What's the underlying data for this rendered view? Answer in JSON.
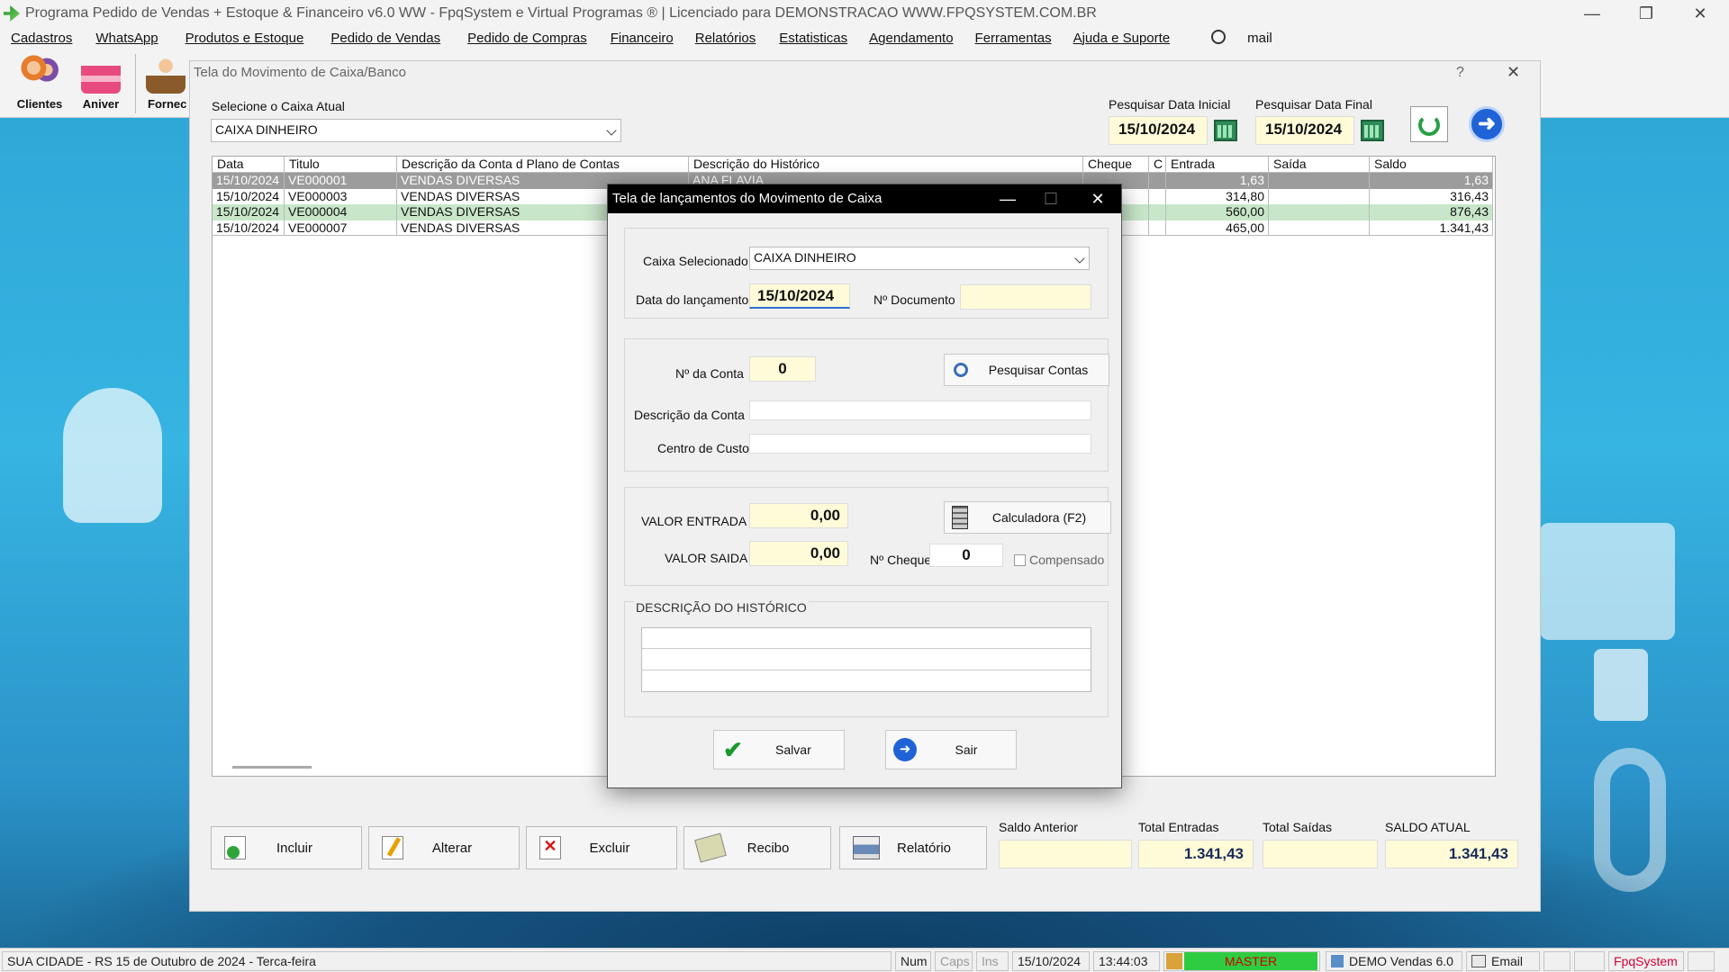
{
  "app": {
    "title": "Programa Pedido de Vendas + Estoque & Financeiro v6.0 WW - FpqSystem e Virtual Programas ® | Licenciado para  DEMONSTRACAO WWW.FPQSYSTEM.COM.BR"
  },
  "menu": [
    "Cadastros",
    "WhatsApp",
    "Produtos e Estoque",
    "Pedido de Vendas",
    "Pedido de Compras",
    "Financeiro",
    "Relatórios",
    "Estatisticas",
    "Agendamento",
    "Ferramentas",
    "Ajuda e Suporte",
    "mail"
  ],
  "toolbar": {
    "clientes": "Clientes",
    "aniver": "Aniver",
    "fornec": "Fornec"
  },
  "mainwin": {
    "title": "Tela do Movimento de Caixa/Banco",
    "help": "?",
    "close": "✕",
    "caixa_label": "Selecione o Caixa Atual",
    "caixa_value": "CAIXA DINHEIRO",
    "data_ini_label": "Pesquisar Data Inicial",
    "data_ini": "15/10/2024",
    "data_fim_label": "Pesquisar Data Final",
    "data_fim": "15/10/2024"
  },
  "table": {
    "headers": [
      "Data",
      "Titulo",
      "Descrição da Conta d Plano de Contas",
      "Descrição do Histórico",
      "Cheque",
      "C",
      "Entrada",
      "Saída",
      "Saldo"
    ],
    "rows": [
      {
        "data": "15/10/2024",
        "titulo": "VE000001",
        "conta": "VENDAS DIVERSAS",
        "hist": "ANA FLAVIA",
        "entrada": "1,63",
        "saida": "",
        "saldo": "1,63"
      },
      {
        "data": "15/10/2024",
        "titulo": "VE000003",
        "conta": "VENDAS DIVERSAS",
        "hist": "",
        "entrada": "314,80",
        "saida": "",
        "saldo": "316,43"
      },
      {
        "data": "15/10/2024",
        "titulo": "VE000004",
        "conta": "VENDAS DIVERSAS",
        "hist": "",
        "entrada": "560,00",
        "saida": "",
        "saldo": "876,43"
      },
      {
        "data": "15/10/2024",
        "titulo": "VE000007",
        "conta": "VENDAS DIVERSAS",
        "hist": "",
        "entrada": "465,00",
        "saida": "",
        "saldo": "1.341,43"
      }
    ]
  },
  "buttons": {
    "incluir": "Incluir",
    "alterar": "Alterar",
    "excluir": "Excluir",
    "recibo": "Recibo",
    "relatorio": "Relatório"
  },
  "totals": {
    "saldo_anterior_label": "Saldo Anterior",
    "saldo_anterior": "",
    "total_entradas_label": "Total Entradas",
    "total_entradas": "1.341,43",
    "total_saidas_label": "Total Saídas",
    "total_saidas": "",
    "saldo_atual_label": "SALDO ATUAL",
    "saldo_atual": "1.341,43"
  },
  "dialog": {
    "title": "Tela de lançamentos do Movimento de Caixa",
    "caixa_label": "Caixa Selecionado",
    "caixa_value": "CAIXA DINHEIRO",
    "data_label": "Data do lançamento",
    "data_value": "15/10/2024",
    "doc_label": "Nº Documento",
    "doc_value": "",
    "conta_label": "Nº da Conta",
    "conta_value": "0",
    "pesquisar_label": "Pesquisar Contas",
    "desc_conta_label": "Descrição da Conta",
    "desc_conta_value": "",
    "centro_label": "Centro de Custo",
    "centro_value": "",
    "entrada_label": "VALOR ENTRADA",
    "entrada_value": "0,00",
    "calc_label": "Calculadora  (F2)",
    "saida_label": "VALOR SAIDA",
    "saida_value": "0,00",
    "cheque_label": "Nº Cheque",
    "cheque_value": "0",
    "compensado_label": "Compensado",
    "hist_label": "DESCRIÇÃO DO HISTÓRICO",
    "salvar_label": "Salvar",
    "sair_label": "Sair"
  },
  "status": {
    "cidade": "SUA CIDADE - RS 15 de Outubro de 2024 - Terca-feira",
    "num": "Num",
    "caps": "Caps",
    "ins": "Ins",
    "date": "15/10/2024",
    "time": "13:44:03",
    "master": "MASTER",
    "demo": "DEMO Vendas 6.0",
    "email": "Email",
    "brand": "FpqSystem"
  },
  "colors": {
    "selected_row": "#9c9c9c",
    "alt_row": "#c8e6c9",
    "input_yellow": "#fffbd9",
    "master_green": "#2ecc40",
    "brand_red": "#d4003a"
  }
}
